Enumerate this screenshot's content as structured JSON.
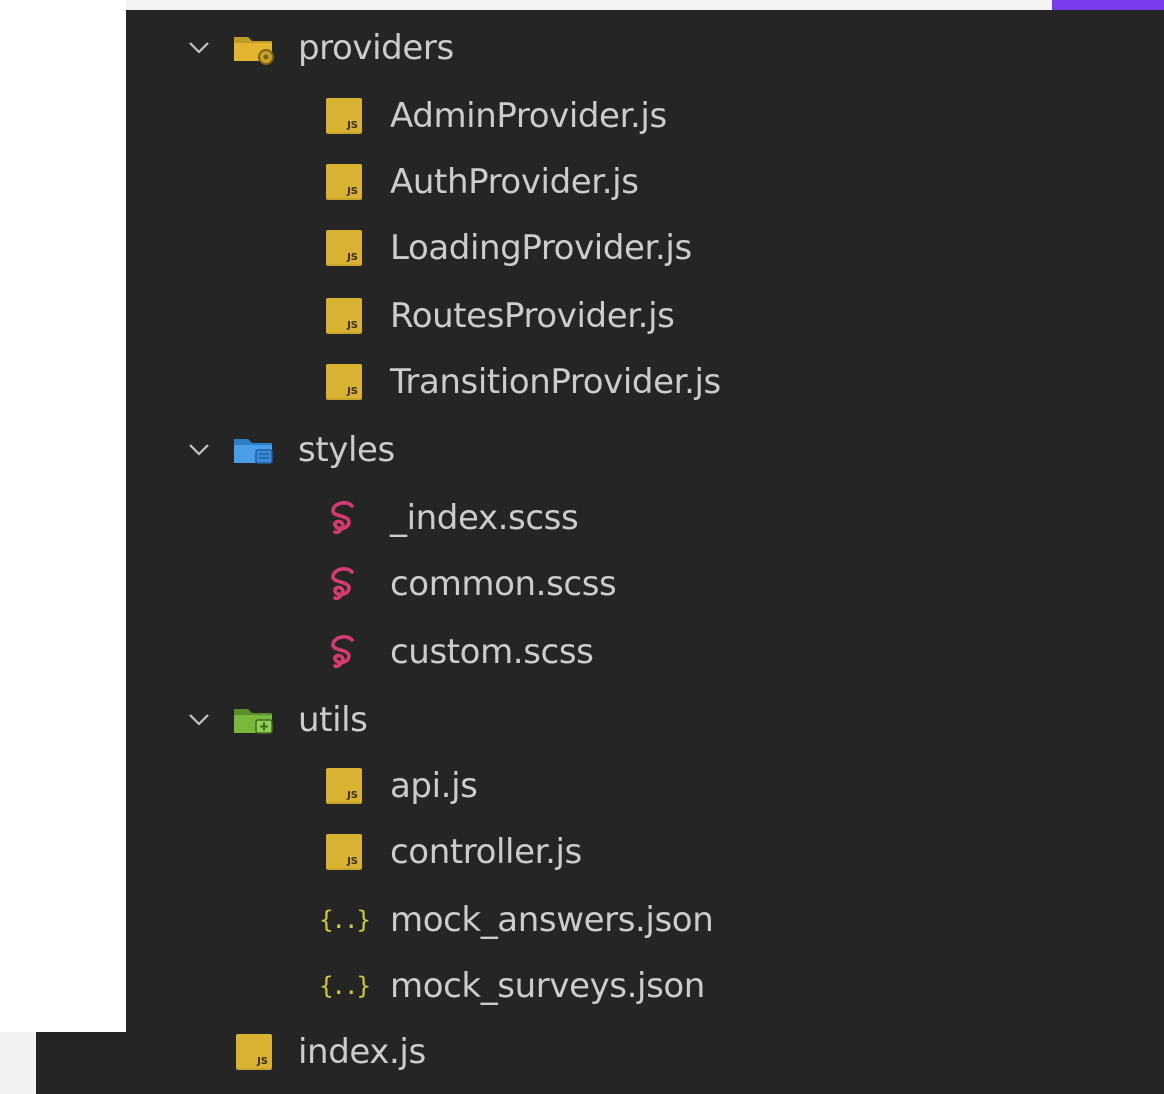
{
  "tree": {
    "providers_folder": {
      "label": "providers",
      "files": [
        "AdminProvider.js",
        "AuthProvider.js",
        "LoadingProvider.js",
        "RoutesProvider.js",
        "TransitionProvider.js"
      ]
    },
    "styles_folder": {
      "label": "styles",
      "files": [
        "_index.scss",
        "common.scss",
        "custom.scss"
      ]
    },
    "utils_folder": {
      "label": "utils",
      "files": [
        "api.js",
        "controller.js",
        "mock_answers.json",
        "mock_surveys.json"
      ]
    },
    "root_file": "index.js"
  },
  "colors": {
    "panel_bg": "#252526",
    "text": "#cccccc",
    "js_yellow": "#d8b230",
    "scss_pink": "#d63a73",
    "json_yellow": "#cbcb41",
    "accent_purple": "#7c3aed"
  }
}
